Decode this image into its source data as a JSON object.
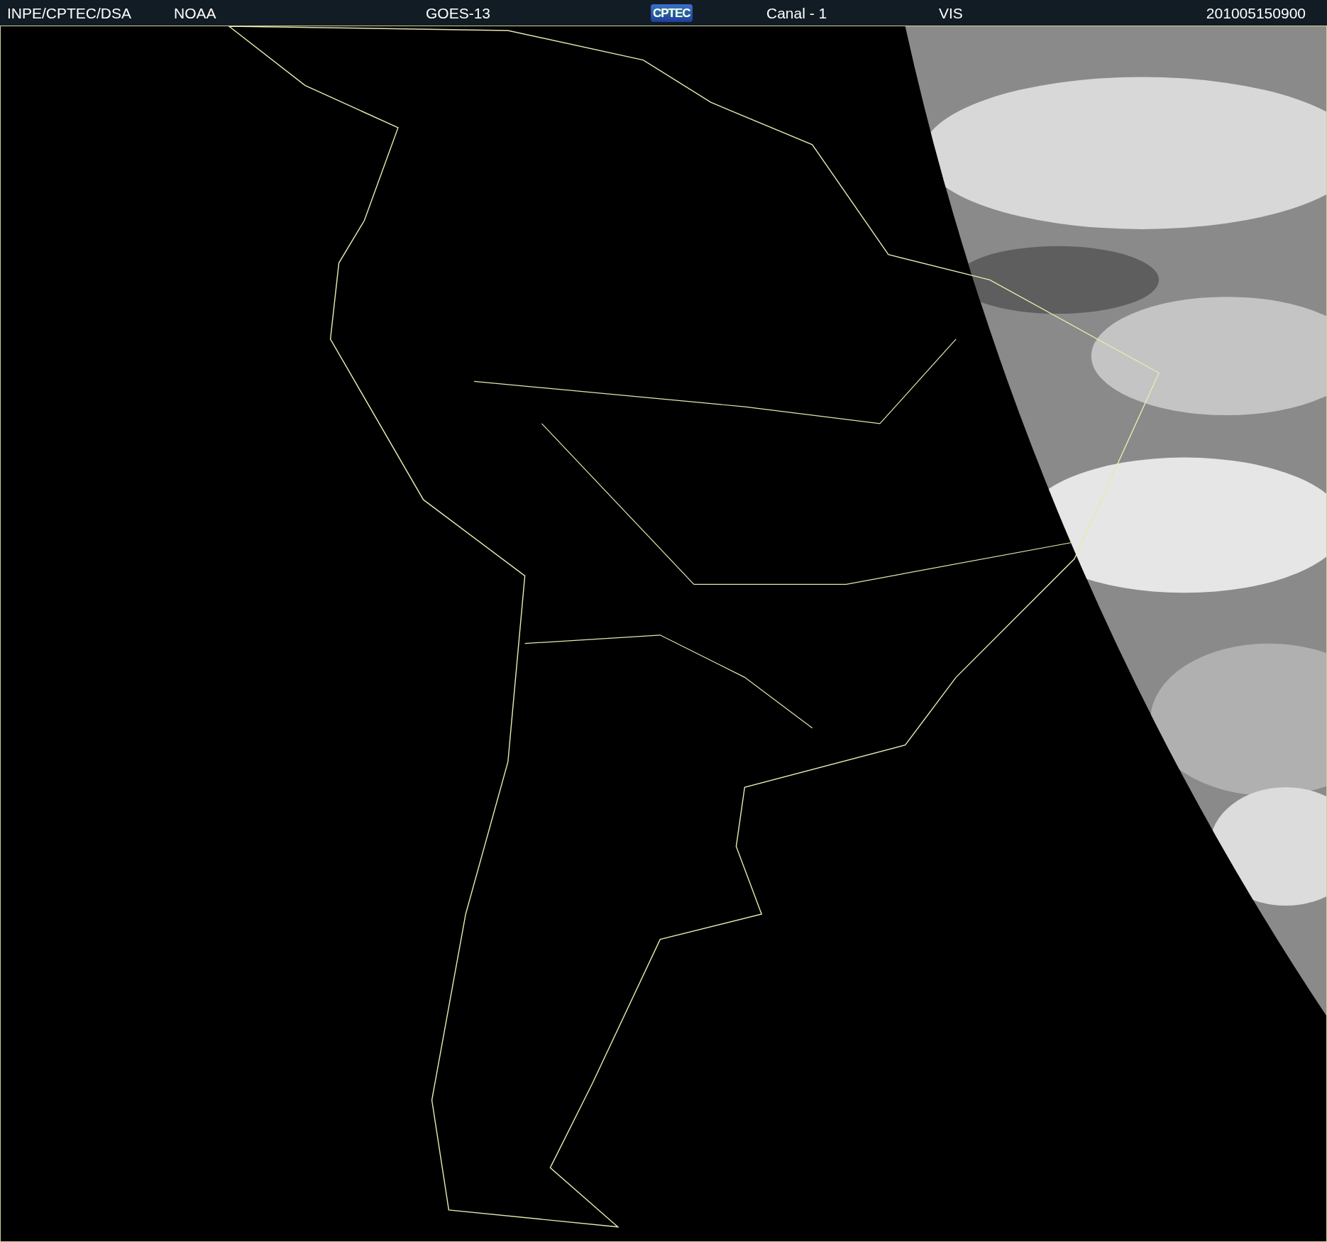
{
  "header": {
    "agencies": [
      "INPE/CPTEC/DSA",
      "NOAA"
    ],
    "satellite": "GOES-13",
    "logo": "CPTEC",
    "channel": "Canal - 1",
    "band": "VIS",
    "timestamp": "201005150900"
  }
}
